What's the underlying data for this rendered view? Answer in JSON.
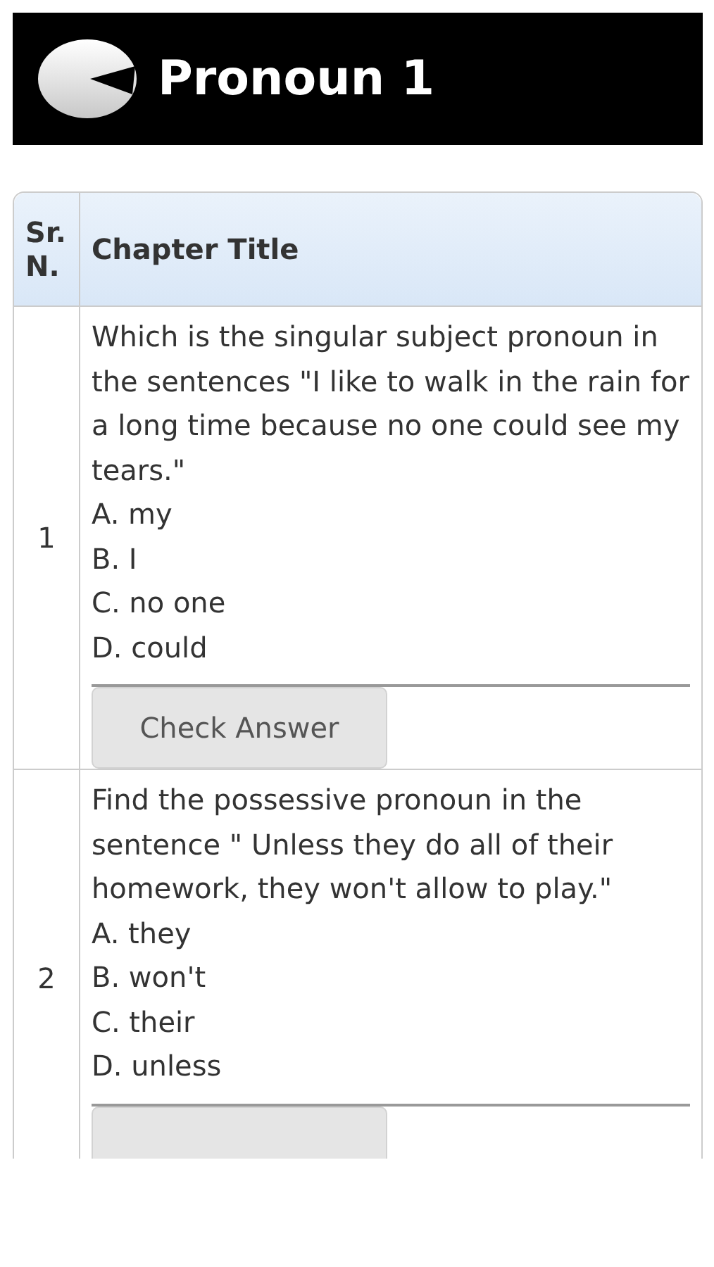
{
  "header": {
    "title": "Pronoun 1"
  },
  "table": {
    "columns": [
      "Sr. N.",
      "Chapter Title"
    ],
    "rows": [
      {
        "number": "1",
        "question": "Which is the singular subject pronoun in the sentences \"I like to walk in the rain for a long time because no one could see my tears.\"",
        "options": [
          "A. my",
          "B. I",
          "C. no one",
          "D. could"
        ],
        "answer_button": {
          "label": "Check Answer"
        }
      },
      {
        "number": "2",
        "question": "Find the possessive pronoun in the sentence \" Unless they do all of their homework, they won't allow to play.\"",
        "options": [
          "A. they",
          "B. won't",
          "C. their",
          "D. unless"
        ],
        "answer_button": {}
      }
    ]
  }
}
